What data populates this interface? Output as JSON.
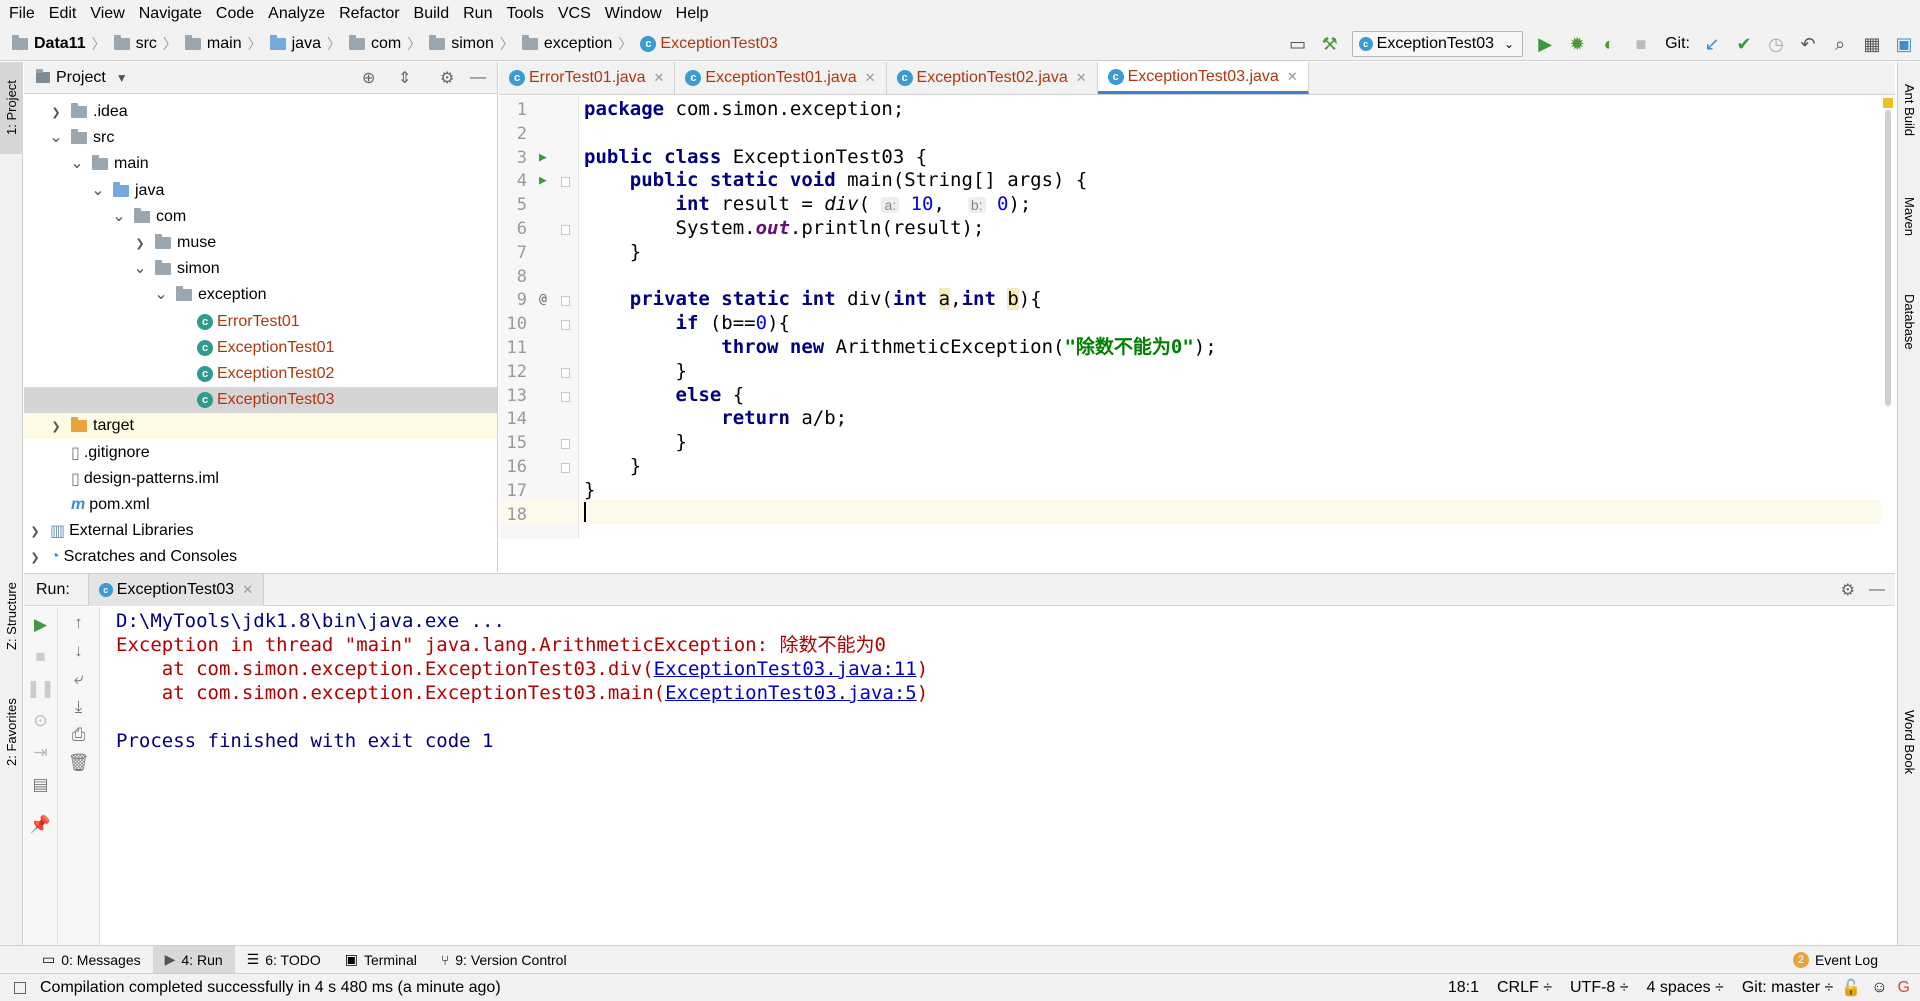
{
  "menu": [
    "File",
    "Edit",
    "View",
    "Navigate",
    "Code",
    "Analyze",
    "Refactor",
    "Build",
    "Run",
    "Tools",
    "VCS",
    "Window",
    "Help"
  ],
  "breadcrumb": {
    "project": "Data11",
    "parts": [
      "src",
      "main",
      "java",
      "com",
      "simon",
      "exception"
    ],
    "file": "ExceptionTest03"
  },
  "toolbar": {
    "run_config": "ExceptionTest03",
    "git_label": "Git:"
  },
  "project_panel": {
    "title": "Project",
    "items": [
      {
        "label": ".idea",
        "depth": 1,
        "arrow": "›",
        "kind": "folder"
      },
      {
        "label": "src",
        "depth": 1,
        "arrow": "⌄",
        "kind": "folder"
      },
      {
        "label": "main",
        "depth": 2,
        "arrow": "⌄",
        "kind": "folder"
      },
      {
        "label": "java",
        "depth": 3,
        "arrow": "⌄",
        "kind": "folder-blue"
      },
      {
        "label": "com",
        "depth": 4,
        "arrow": "⌄",
        "kind": "folder"
      },
      {
        "label": "muse",
        "depth": 5,
        "arrow": "›",
        "kind": "folder"
      },
      {
        "label": "simon",
        "depth": 5,
        "arrow": "⌄",
        "kind": "folder"
      },
      {
        "label": "exception",
        "depth": 6,
        "arrow": "⌄",
        "kind": "folder"
      },
      {
        "label": "ErrorTest01",
        "depth": 7,
        "arrow": "",
        "kind": "class"
      },
      {
        "label": "ExceptionTest01",
        "depth": 7,
        "arrow": "",
        "kind": "class"
      },
      {
        "label": "ExceptionTest02",
        "depth": 7,
        "arrow": "",
        "kind": "class"
      },
      {
        "label": "ExceptionTest03",
        "depth": 7,
        "arrow": "",
        "kind": "class",
        "selected": true
      },
      {
        "label": "target",
        "depth": 1,
        "arrow": "›",
        "kind": "folder-orange"
      },
      {
        "label": ".gitignore",
        "depth": 1,
        "arrow": "",
        "kind": "file"
      },
      {
        "label": "design-patterns.iml",
        "depth": 1,
        "arrow": "",
        "kind": "file"
      },
      {
        "label": "pom.xml",
        "depth": 1,
        "arrow": "",
        "kind": "maven"
      },
      {
        "label": "External Libraries",
        "depth": 0,
        "arrow": "›",
        "kind": "lib"
      },
      {
        "label": "Scratches and Consoles",
        "depth": 0,
        "arrow": "›",
        "kind": "scratch"
      }
    ]
  },
  "editor_tabs": [
    "ErrorTest01.java",
    "ExceptionTest01.java",
    "ExceptionTest02.java",
    "ExceptionTest03.java"
  ],
  "line_numbers": [
    "1",
    "2",
    "3",
    "4",
    "5",
    "6",
    "7",
    "8",
    "9",
    "10",
    "11",
    "12",
    "13",
    "14",
    "15",
    "16",
    "17",
    "18"
  ],
  "code": {
    "l1_kw": "package",
    "l1_rest": " com.simon.exception;",
    "l3_kw": "public class",
    "l3_rest": " ExceptionTest03 {",
    "l4_kw": "public static void",
    "l4_rest": " main(String[] args) {",
    "l5_kw": "int",
    "l5_a": " result = ",
    "l5_div": "div",
    "l5_p": "(",
    "l5_hint_a": "a:",
    "l5_n1": "10",
    "l5_c": ", ",
    "l5_hint_b": "b:",
    "l5_n2": "0",
    "l5_end": ");",
    "l6_a": "System.",
    "l6_out": "out",
    "l6_b": ".println(result);",
    "l7": "}",
    "l9_kw": "private static int",
    "l9_a": " div(",
    "l9_kw2": "int",
    "l9_pa": "a",
    "l9_c": ",",
    "l9_kw3": "int",
    "l9_pb": "b",
    "l9_end": "){",
    "l10_kw": "if",
    "l10_a": " (b==",
    "l10_n": "0",
    "l10_b": "){",
    "l11_kw": "throw new",
    "l11_a": " ArithmeticException(",
    "l11_str": "\"除数不能为0\"",
    "l11_b": ");",
    "l12": "}",
    "l13_kw": "else",
    "l13_a": " {",
    "l14_kw": "return",
    "l14_a": " a/b;",
    "l15": "}",
    "l16": "}",
    "l17": "}"
  },
  "run_panel": {
    "label": "Run:",
    "tab": "ExceptionTest03",
    "console": {
      "cmd": "D:\\MyTools\\jdk1.8\\bin\\java.exe ...",
      "exc": "Exception in thread \"main\" java.lang.ArithmeticException: 除数不能为0",
      "at1_a": "    at com.simon.exception.ExceptionTest03.div(",
      "at1_link": "ExceptionTest03.java:11",
      "at1_b": ")",
      "at2_a": "    at com.simon.exception.ExceptionTest03.main(",
      "at2_link": "ExceptionTest03.java:5",
      "at2_b": ")",
      "finish": "Process finished with exit code 1"
    }
  },
  "left_tabs": {
    "project": "1: Project",
    "structure": "Z: Structure",
    "favorites": "2: Favorites"
  },
  "right_tabs": {
    "ant": "Ant Build",
    "maven": "Maven",
    "database": "Database",
    "wordbook": "Word Book"
  },
  "bottom_tabs": [
    "0: Messages",
    "4: Run",
    "6: TODO",
    "Terminal",
    "9: Version Control"
  ],
  "event_log": {
    "count": "2",
    "label": "Event Log"
  },
  "status": {
    "message": "Compilation completed successfully in 4 s 480 ms (a minute ago)",
    "position": "18:1",
    "line_sep": "CRLF ÷",
    "encoding": "UTF-8 ÷",
    "indent": "4 spaces ÷",
    "git": "Git: master ÷"
  },
  "colors": {
    "keyword": "#000080",
    "number": "#0000ff",
    "string": "#008000",
    "error": "#b00000",
    "accent": "#4083c9"
  }
}
